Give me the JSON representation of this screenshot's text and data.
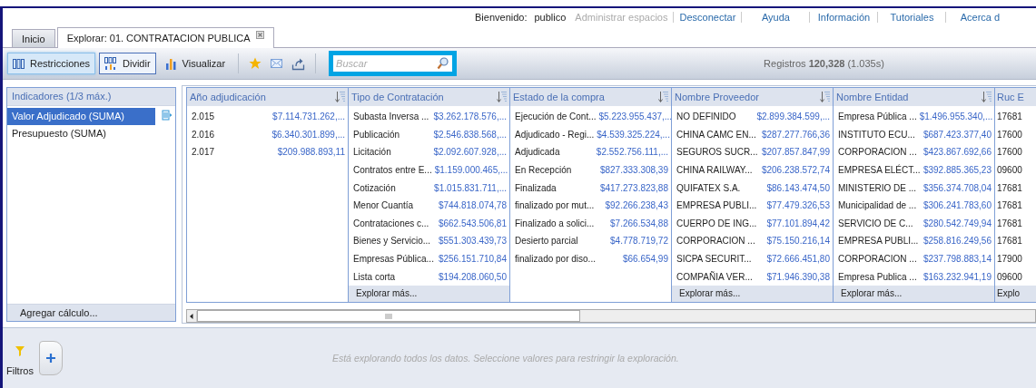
{
  "top_bar": {
    "welcome_label": "Bienvenido:",
    "user": "publico",
    "links": [
      {
        "label": "Administrar espacios",
        "disabled": true
      },
      {
        "label": "Desconectar",
        "disabled": false
      },
      {
        "label": "Ayuda",
        "disabled": false
      },
      {
        "label": "Información",
        "disabled": false
      },
      {
        "label": "Tutoriales",
        "disabled": false
      },
      {
        "label": "Acerca d",
        "disabled": false
      }
    ]
  },
  "tabs": [
    {
      "label": "Inicio",
      "selected": false,
      "closable": false
    },
    {
      "label": "Explorar: 01. CONTRATACION PUBLICA",
      "selected": true,
      "closable": true
    }
  ],
  "toolbar": {
    "buttons": [
      {
        "kind": "restrict",
        "label": "Restricciones",
        "pressed": true,
        "outlined": false
      },
      {
        "kind": "split",
        "label": "Dividir",
        "pressed": false,
        "outlined": true
      },
      {
        "kind": "chart",
        "label": "Visualizar",
        "pressed": false,
        "outlined": false
      }
    ],
    "icon_buttons": [
      {
        "kind": "star"
      },
      {
        "kind": "mail"
      },
      {
        "kind": "export"
      }
    ],
    "search": {
      "placeholder": "Buscar",
      "highlighted": true
    },
    "records": "Registros **120,328** (1.035s)"
  },
  "indicators": {
    "title": "Indicadores (1/3 máx.)",
    "items": [
      {
        "label": "Valor Adjudicado (SUMA)",
        "selected": true
      },
      {
        "label": "Presupuesto (SUMA)",
        "selected": false
      }
    ],
    "footer": "Agregar cálculo..."
  },
  "columns": [
    {
      "title": "Año adjudicación",
      "rows": [
        {
          "label": "2.015",
          "value": "$7.114.731.262,..."
        },
        {
          "label": "2.016",
          "value": "$6.340.301.899,..."
        },
        {
          "label": "2.017",
          "value": "$209.988.893,11"
        }
      ]
    },
    {
      "title": "Tipo de Contratación",
      "footer": "Explorar más...",
      "rows": [
        {
          "label": "Subasta Inversa ...",
          "value": "$3.262.178.576,..."
        },
        {
          "label": "Publicación",
          "value": "$2.546.838.568,..."
        },
        {
          "label": "Licitación",
          "value": "$2.092.607.928,..."
        },
        {
          "label": "Contratos entre E...",
          "value": "$1.159.000.465,..."
        },
        {
          "label": "Cotización",
          "value": "$1.015.831.711,..."
        },
        {
          "label": "Menor Cuantía",
          "value": "$744.818.074,78"
        },
        {
          "label": "Contrataciones c...",
          "value": "$662.543.506,81"
        },
        {
          "label": "Bienes y Servicio...",
          "value": "$551.303.439,73"
        },
        {
          "label": "Empresas Pública...",
          "value": "$256.151.710,84"
        },
        {
          "label": "Lista corta",
          "value": "$194.208.060,50"
        }
      ]
    },
    {
      "title": "Estado de la compra",
      "rows": [
        {
          "label": "Ejecución de Cont...",
          "value": "$5.223.955.437,..."
        },
        {
          "label": "Adjudicado - Regi...",
          "value": "$4.539.325.224,..."
        },
        {
          "label": "Adjudicada",
          "value": "$2.552.756.111,..."
        },
        {
          "label": "En Recepción",
          "value": "$827.333.308,39"
        },
        {
          "label": "Finalizada",
          "value": "$417.273.823,88"
        },
        {
          "label": "finalizado por mut...",
          "value": "$92.266.238,43"
        },
        {
          "label": "Finalizado a solici...",
          "value": "$7.266.534,88"
        },
        {
          "label": "Desierto parcial",
          "value": "$4.778.719,72"
        },
        {
          "label": "finalizado por diso...",
          "value": "$66.654,99"
        }
      ]
    },
    {
      "title": "Nombre Proveedor",
      "footer": "Explorar más...",
      "rows": [
        {
          "label": "NO DEFINIDO",
          "value": "$2.899.384.599,..."
        },
        {
          "label": "CHINA CAMC EN...",
          "value": "$287.277.766,36"
        },
        {
          "label": "SEGUROS SUCR...",
          "value": "$207.857.847,99"
        },
        {
          "label": "CHINA RAILWAY...",
          "value": "$206.238.572,74"
        },
        {
          "label": "QUIFATEX S.A.",
          "value": "$86.143.474,50"
        },
        {
          "label": "EMPRESA PUBLI...",
          "value": "$77.479.326,53"
        },
        {
          "label": "CUERPO DE ING...",
          "value": "$77.101.894,42"
        },
        {
          "label": "CORPORACION ...",
          "value": "$75.150.216,14"
        },
        {
          "label": "SICPA SECURIT...",
          "value": "$72.666.451,80"
        },
        {
          "label": "COMPAÑIA VER...",
          "value": "$71.946.390,38"
        }
      ]
    },
    {
      "title": "Nombre Entidad",
      "footer": "Explorar más...",
      "rows": [
        {
          "label": "Empresa Pública ...",
          "value": "$1.496.955.340,..."
        },
        {
          "label": "INSTITUTO ECU...",
          "value": "$687.423.377,40"
        },
        {
          "label": "CORPORACION ...",
          "value": "$423.867.692,66"
        },
        {
          "label": "EMPRESA ELÉCT...",
          "value": "$392.885.365,23"
        },
        {
          "label": "MINISTERIO DE ...",
          "value": "$356.374.708,04"
        },
        {
          "label": "Municipalidad de ...",
          "value": "$306.241.783,60"
        },
        {
          "label": "SERVICIO DE C...",
          "value": "$280.542.749,94"
        },
        {
          "label": "EMPRESA PUBLI...",
          "value": "$258.816.249,56"
        },
        {
          "label": "CORPORACION ...",
          "value": "$237.798.883,14"
        },
        {
          "label": "Empresa Publica ...",
          "value": "$163.232.941,19"
        }
      ]
    },
    {
      "title": "Ruc E",
      "footer": "Explo",
      "rows": [
        {
          "label": "17681"
        },
        {
          "label": "17600"
        },
        {
          "label": "17600"
        },
        {
          "label": "09600"
        },
        {
          "label": "17681"
        },
        {
          "label": "17681"
        },
        {
          "label": "17681"
        },
        {
          "label": "17681"
        },
        {
          "label": "17900"
        },
        {
          "label": "09600"
        }
      ]
    }
  ],
  "filters": {
    "label": "Filtros",
    "message": "Está explorando todos los datos. Seleccione valores para restringir la exploración."
  }
}
